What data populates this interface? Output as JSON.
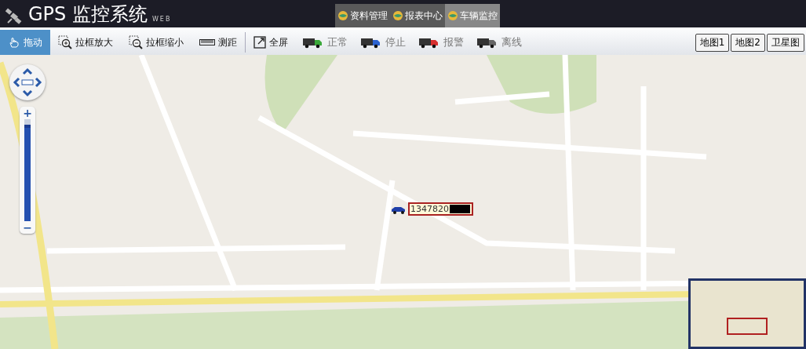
{
  "header": {
    "title": "GPS 监控系统",
    "subtitle": "WEB",
    "tabs": [
      {
        "label": "资料管理",
        "selected": false
      },
      {
        "label": "报表中心",
        "selected": false
      },
      {
        "label": "车辆监控",
        "selected": true
      }
    ]
  },
  "toolbar": {
    "tools": [
      {
        "label": "拖动",
        "kind": "hand",
        "selected": true
      },
      {
        "label": "拉框放大",
        "kind": "zoomin",
        "selected": false
      },
      {
        "label": "拉框缩小",
        "kind": "zoomout",
        "selected": false
      },
      {
        "label": "测距",
        "kind": "ruler",
        "selected": false
      },
      {
        "label": "全屏",
        "kind": "fullscreen",
        "selected": false
      }
    ],
    "legend": [
      {
        "label": "正常",
        "color": "#3aa83a"
      },
      {
        "label": "停止",
        "color": "#2b62d0"
      },
      {
        "label": "报警",
        "color": "#d83030"
      },
      {
        "label": "离线",
        "color": "#666666"
      }
    ],
    "map_types": [
      {
        "label": "地图1"
      },
      {
        "label": "地图2"
      },
      {
        "label": "卫星图"
      }
    ]
  },
  "map": {
    "zoom": {
      "in": "+",
      "out": "−",
      "level": 0.95
    },
    "vehicle": {
      "label": "1347820"
    }
  }
}
